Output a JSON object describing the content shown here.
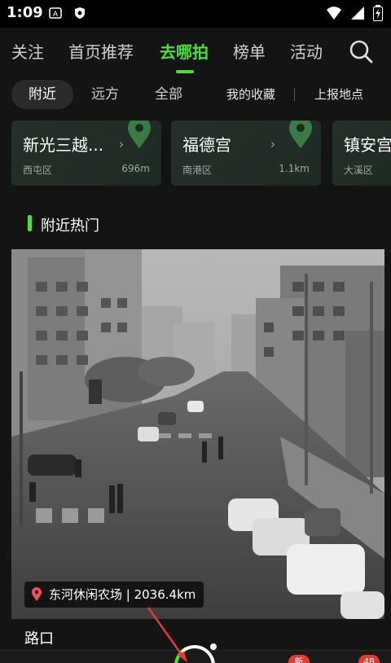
{
  "status_bar": {
    "time": "1:09",
    "icons": [
      "a-notification-icon",
      "shield-icon",
      "wifi-icon",
      "signal-icon",
      "battery-icon"
    ]
  },
  "main_tabs": [
    {
      "label": "关注",
      "active": false
    },
    {
      "label": "首页推荐",
      "active": false
    },
    {
      "label": "去哪拍",
      "active": true
    },
    {
      "label": "榜单",
      "active": false
    },
    {
      "label": "活动",
      "active": false
    }
  ],
  "search_icon": "search-icon",
  "sub_tabs": [
    {
      "label": "附近",
      "active": true
    },
    {
      "label": "远方",
      "active": false
    },
    {
      "label": "全部",
      "active": false
    }
  ],
  "sub_actions": {
    "favorites": "我的收藏",
    "report": "上报地点"
  },
  "locations": [
    {
      "name": "新光三越...",
      "district": "西屯区",
      "distance": "696m",
      "chevron": "›"
    },
    {
      "name": "福德宫",
      "district": "南港区",
      "distance": "1.1km",
      "chevron": "›"
    },
    {
      "name": "镇安宫",
      "district": "大溪区",
      "distance": "",
      "chevron": ""
    }
  ],
  "section": {
    "title": "附近热门",
    "accent": "#4be03a"
  },
  "post": {
    "location_tag": "东河休闲农场 | 2036.4km",
    "title": "路口"
  },
  "bottom_bar": {
    "left_label": "   ",
    "badge_new": "新",
    "badge_count": "48"
  },
  "colors": {
    "accent": "#4be03a",
    "background": "#141414",
    "badge": "#e53935",
    "pin": "#ff4d5a"
  }
}
